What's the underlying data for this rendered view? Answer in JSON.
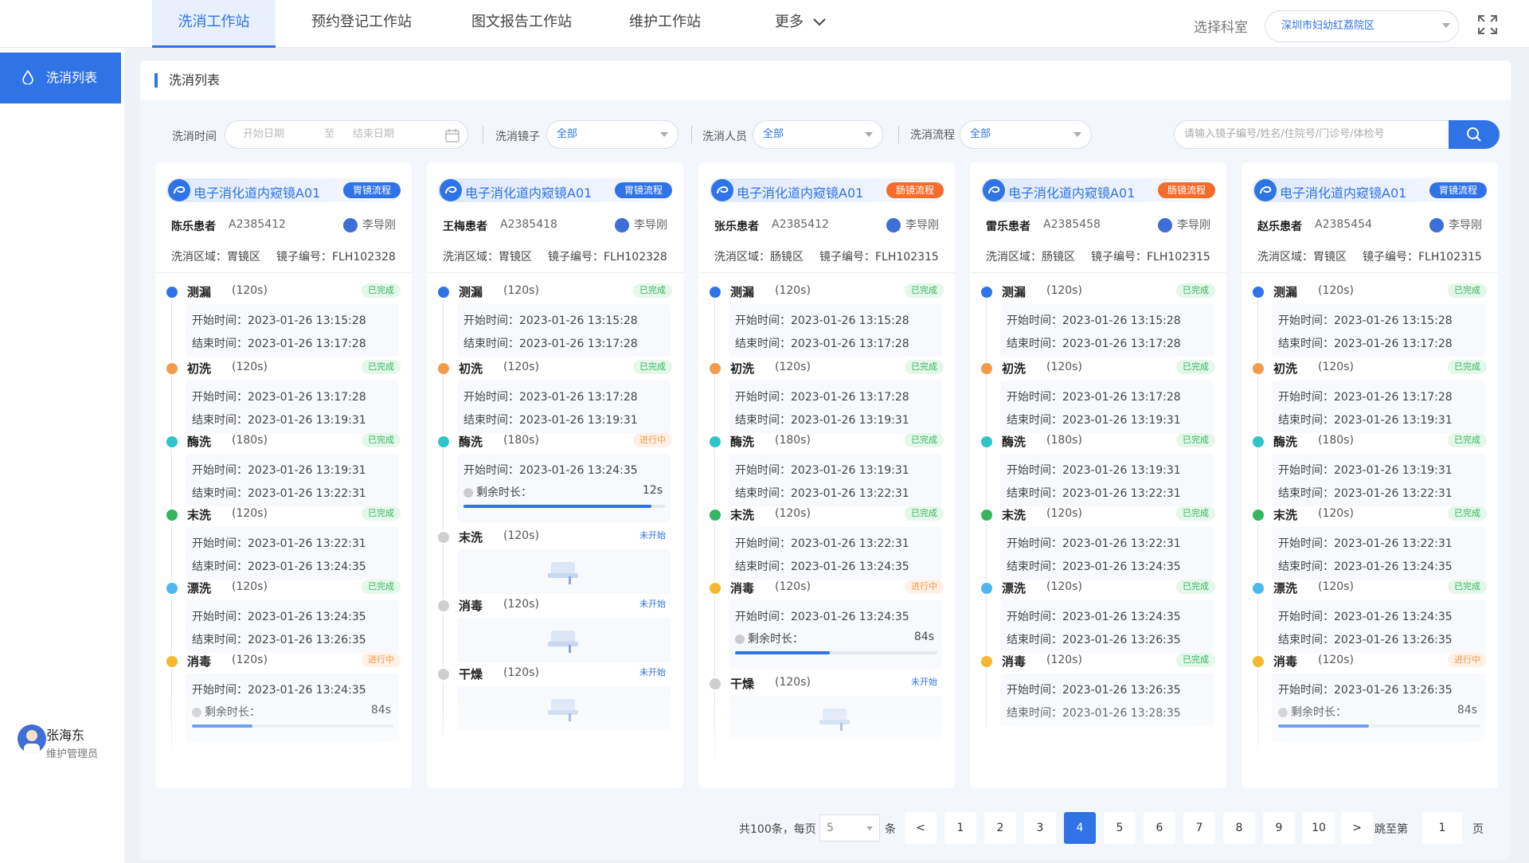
{
  "nav": {
    "tabs": [
      "洗消工作站",
      "预约登记工作站",
      "图文报告工作站",
      "维护工作站",
      "更多"
    ],
    "dept_label": "选择科室",
    "dept_value": "深圳市妇幼红荔院区"
  },
  "sidebar": {
    "item": "洗消列表",
    "user_name": "张海东",
    "user_role": "维护管理员"
  },
  "section_title": "洗消列表",
  "filters": {
    "time_label": "洗消时间",
    "start_ph": "开始日期",
    "to": "至",
    "end_ph": "结束日期",
    "scope_label": "洗消镜子",
    "scope_val": "全部",
    "staff_label": "洗消人员",
    "staff_val": "全部",
    "flow_label": "洗消流程",
    "flow_val": "全部",
    "search_ph": "请输入镜子编号/姓名/住院号/门诊号/体检号"
  },
  "labels": {
    "zone": "洗消区域：",
    "scope_no": "镜子编号：",
    "start": "开始时间：",
    "end": "结束时间：",
    "remain": "剩余时长：",
    "done": "已完成",
    "run": "进行中",
    "wait": "未开始"
  },
  "colors": {
    "accent": "#2f73e6",
    "gastric_badge": "#2f73e6",
    "colon_badge": "#f56c2b",
    "done": "#35b560",
    "running": "#f39b4a"
  },
  "cards": [
    {
      "device": "电子消化道内窥镜A01",
      "flow": "胃镜流程",
      "patient": "陈乐患者",
      "pid": "A2385412",
      "doctor": "李导刚",
      "zone": "胃镜区",
      "scope_no": "FLH102328",
      "steps": [
        {
          "name": "测漏",
          "dur": "(120s)",
          "status": "done",
          "color": "#2f73e6",
          "start": "2023-01-26  13:15:28",
          "end": "2023-01-26  13:17:28"
        },
        {
          "name": "初洗",
          "dur": "(120s)",
          "status": "done",
          "color": "#f39b4a",
          "start": "2023-01-26  13:17:28",
          "end": "2023-01-26  13:19:31"
        },
        {
          "name": "酶洗",
          "dur": "(180s)",
          "status": "done",
          "color": "#30c4c9",
          "start": "2023-01-26  13:19:31",
          "end": "2023-01-26  13:22:31"
        },
        {
          "name": "末洗",
          "dur": "(120s)",
          "status": "done",
          "color": "#35b560",
          "start": "2023-01-26  13:22:31",
          "end": "2023-01-26  13:24:35"
        },
        {
          "name": "漂洗",
          "dur": "(120s)",
          "status": "done",
          "color": "#4fb7f0",
          "start": "2023-01-26  13:24:35",
          "end": "2023-01-26  13:26:35"
        },
        {
          "name": "消毒",
          "dur": "(120s)",
          "status": "run",
          "color": "#f5b82e",
          "start": "2023-01-26  13:24:35",
          "remain": "84s",
          "progress": 0.3
        }
      ]
    },
    {
      "device": "电子消化道内窥镜A01",
      "flow": "胃镜流程",
      "patient": "王梅患者",
      "pid": "A2385418",
      "doctor": "李导刚",
      "zone": "胃镜区",
      "scope_no": "FLH102328",
      "steps": [
        {
          "name": "测漏",
          "dur": "(120s)",
          "status": "done",
          "color": "#2f73e6",
          "start": "2023-01-26  13:15:28",
          "end": "2023-01-26  13:17:28"
        },
        {
          "name": "初洗",
          "dur": "(120s)",
          "status": "done",
          "color": "#f39b4a",
          "start": "2023-01-26  13:17:28",
          "end": "2023-01-26  13:19:31"
        },
        {
          "name": "酶洗",
          "dur": "(180s)",
          "status": "run",
          "color": "#30c4c9",
          "start": "2023-01-26  13:24:35",
          "remain": "12s",
          "progress": 0.93
        },
        {
          "name": "末洗",
          "dur": "(120s)",
          "status": "wait",
          "color": "#cfcfcf"
        },
        {
          "name": "消毒",
          "dur": "(120s)",
          "status": "wait",
          "color": "#cfcfcf"
        },
        {
          "name": "干燥",
          "dur": "(120s)",
          "status": "wait",
          "color": "#cfcfcf"
        }
      ]
    },
    {
      "device": "电子消化道内窥镜A01",
      "flow": "肠镜流程",
      "patient": "张乐患者",
      "pid": "A2385412",
      "doctor": "李导刚",
      "zone": "肠镜区",
      "scope_no": "FLH102315",
      "steps": [
        {
          "name": "测漏",
          "dur": "(120s)",
          "status": "done",
          "color": "#2f73e6",
          "start": "2023-01-26  13:15:28",
          "end": "2023-01-26  13:17:28"
        },
        {
          "name": "初洗",
          "dur": "(120s)",
          "status": "done",
          "color": "#f39b4a",
          "start": "2023-01-26  13:17:28",
          "end": "2023-01-26  13:19:31"
        },
        {
          "name": "酶洗",
          "dur": "(180s)",
          "status": "done",
          "color": "#30c4c9",
          "start": "2023-01-26  13:19:31",
          "end": "2023-01-26  13:22:31"
        },
        {
          "name": "末洗",
          "dur": "(120s)",
          "status": "done",
          "color": "#35b560",
          "start": "2023-01-26  13:22:31",
          "end": "2023-01-26  13:24:35"
        },
        {
          "name": "消毒",
          "dur": "(120s)",
          "status": "run",
          "color": "#f5b82e",
          "start": "2023-01-26  13:24:35",
          "remain": "84s",
          "progress": 0.47
        },
        {
          "name": "干燥",
          "dur": "(120s)",
          "status": "wait",
          "color": "#cfcfcf"
        }
      ]
    },
    {
      "device": "电子消化道内窥镜A01",
      "flow": "肠镜流程",
      "patient": "雷乐患者",
      "pid": "A2385458",
      "doctor": "李导刚",
      "zone": "肠镜区",
      "scope_no": "FLH102315",
      "steps": [
        {
          "name": "测漏",
          "dur": "(120s)",
          "status": "done",
          "color": "#2f73e6",
          "start": "2023-01-26  13:15:28",
          "end": "2023-01-26  13:17:28"
        },
        {
          "name": "初洗",
          "dur": "(120s)",
          "status": "done",
          "color": "#f39b4a",
          "start": "2023-01-26  13:17:28",
          "end": "2023-01-26  13:19:31"
        },
        {
          "name": "酶洗",
          "dur": "(180s)",
          "status": "done",
          "color": "#30c4c9",
          "start": "2023-01-26  13:19:31",
          "end": "2023-01-26  13:22:31"
        },
        {
          "name": "末洗",
          "dur": "(120s)",
          "status": "done",
          "color": "#35b560",
          "start": "2023-01-26  13:22:31",
          "end": "2023-01-26  13:24:35"
        },
        {
          "name": "漂洗",
          "dur": "(120s)",
          "status": "done",
          "color": "#4fb7f0",
          "start": "2023-01-26  13:24:35",
          "end": "2023-01-26  13:26:35"
        },
        {
          "name": "消毒",
          "dur": "(120s)",
          "status": "done",
          "color": "#f5b82e",
          "start": "2023-01-26  13:26:35",
          "end": "2023-01-26  13:28:35"
        }
      ]
    },
    {
      "device": "电子消化道内窥镜A01",
      "flow": "胃镜流程",
      "patient": "赵乐患者",
      "pid": "A2385454",
      "doctor": "李导刚",
      "zone": "胃镜区",
      "scope_no": "FLH102315",
      "steps": [
        {
          "name": "测漏",
          "dur": "(120s)",
          "status": "done",
          "color": "#2f73e6",
          "start": "2023-01-26  13:15:28",
          "end": "2023-01-26  13:17:28"
        },
        {
          "name": "初洗",
          "dur": "(120s)",
          "status": "done",
          "color": "#f39b4a",
          "start": "2023-01-26  13:17:28",
          "end": "2023-01-26  13:19:31"
        },
        {
          "name": "酶洗",
          "dur": "(180s)",
          "status": "done",
          "color": "#30c4c9",
          "start": "2023-01-26  13:19:31",
          "end": "2023-01-26  13:22:31"
        },
        {
          "name": "末洗",
          "dur": "(120s)",
          "status": "done",
          "color": "#35b560",
          "start": "2023-01-26  13:22:31",
          "end": "2023-01-26  13:24:35"
        },
        {
          "name": "漂洗",
          "dur": "(120s)",
          "status": "done",
          "color": "#4fb7f0",
          "start": "2023-01-26  13:24:35",
          "end": "2023-01-26  13:26:35"
        },
        {
          "name": "消毒",
          "dur": "(120s)",
          "status": "run",
          "color": "#f5b82e",
          "start": "2023-01-26  13:26:35",
          "remain": "84s",
          "progress": 0.45
        }
      ]
    }
  ],
  "pagination": {
    "total": "共100条，每页",
    "per_page": "5",
    "unit": "条",
    "prev": "<",
    "next": ">",
    "pages": [
      "1",
      "2",
      "3",
      "4",
      "5",
      "6",
      "7",
      "8",
      "9",
      "10"
    ],
    "current": "4",
    "jump_label": "跳至第",
    "jump_value": "1",
    "page_suffix": "页"
  }
}
